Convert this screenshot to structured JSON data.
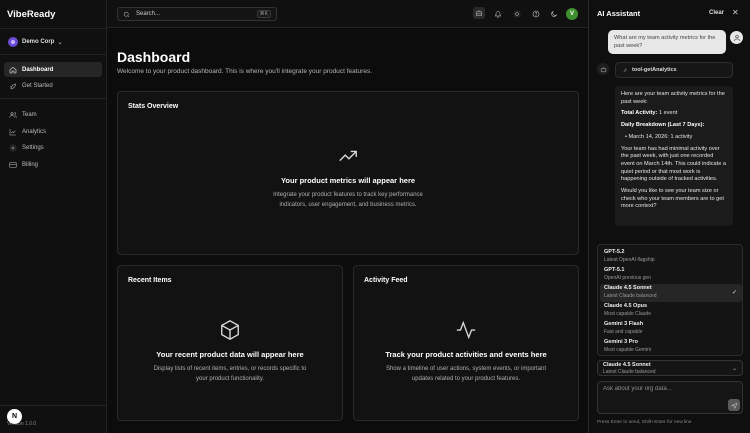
{
  "app": {
    "brand": "VibeReady",
    "version": "Version 1.0.0",
    "logo_letter": "N"
  },
  "org": {
    "name": "Demo Corp"
  },
  "nav": [
    {
      "label": "Dashboard",
      "icon": "home-icon",
      "active": true
    },
    {
      "label": "Get Started",
      "icon": "rocket-icon",
      "active": false
    },
    {
      "label": "Team",
      "icon": "users-icon",
      "active": false
    },
    {
      "label": "Analytics",
      "icon": "chart-icon",
      "active": false
    },
    {
      "label": "Settings",
      "icon": "gear-icon",
      "active": false
    },
    {
      "label": "Billing",
      "icon": "card-icon",
      "active": false
    }
  ],
  "topbar": {
    "search_placeholder": "Search...",
    "search_shortcut": "⌘K",
    "user_initial": "V",
    "icons": [
      "bot-icon",
      "bell-icon",
      "sun-icon",
      "help-icon",
      "moon-icon"
    ]
  },
  "main": {
    "title": "Dashboard",
    "subtitle": "Welcome to your product dashboard. This is where you'll integrate your product features.",
    "stats": {
      "title": "Stats Overview",
      "empty_title": "Your product metrics will appear here",
      "empty_desc": "Integrate your product features to track key performance indicators, user engagement, and business metrics."
    },
    "recent": {
      "title": "Recent Items",
      "empty_title": "Your recent product data will appear here",
      "empty_desc": "Display lists of recent items, entries, or records specific to your product functionality."
    },
    "activity": {
      "title": "Activity Feed",
      "empty_title": "Track your product activities and events here",
      "empty_desc": "Show a timeline of user actions, system events, or important updates related to your product features."
    }
  },
  "assistant": {
    "title": "AI Assistant",
    "clear_label": "Clear",
    "close_label": "✕",
    "user_message": "What are my team activity metrics for the past week?",
    "tool_call": "tool-getAnalytics",
    "reply": {
      "intro": "Here are your team activity metrics for the past week:",
      "total_label": "Total Activity:",
      "total_value": "1 event",
      "breakdown_label": "Daily Breakdown (Last 7 Days):",
      "bullet": "March 14, 2026: 1 activity",
      "analysis": "Your team has had minimal activity over the past week, with just one recorded event on March 14th. This could indicate a quiet period or that most work is happening outside of tracked activities.",
      "question": "Would you like to see your team size or check who your team members are to get more context?"
    },
    "models": [
      {
        "name": "GPT-5.2",
        "desc": "Latest OpenAI flagship",
        "selected": false
      },
      {
        "name": "GPT-5.1",
        "desc": "OpenAI previous gen",
        "selected": false
      },
      {
        "name": "Claude 4.5 Sonnet",
        "desc": "Latest Claude balanced",
        "selected": true
      },
      {
        "name": "Claude 4.5 Opus",
        "desc": "Most capable Claude",
        "selected": false
      },
      {
        "name": "Gemini 3 Flash",
        "desc": "Fast and capable",
        "selected": false
      },
      {
        "name": "Gemini 3 Pro",
        "desc": "Most capable Gemini",
        "selected": false
      }
    ],
    "current_model": {
      "name": "Claude 4.5 Sonnet",
      "desc": "Latest Claude balanced"
    },
    "input_placeholder": "Ask about your org data...",
    "hint": "Press Enter to send, Shift+Enter for new line"
  },
  "colors": {
    "accent_org": "#6d4cd6",
    "avatar_green": "#3d8f2f",
    "background": "#0c0c0c"
  }
}
